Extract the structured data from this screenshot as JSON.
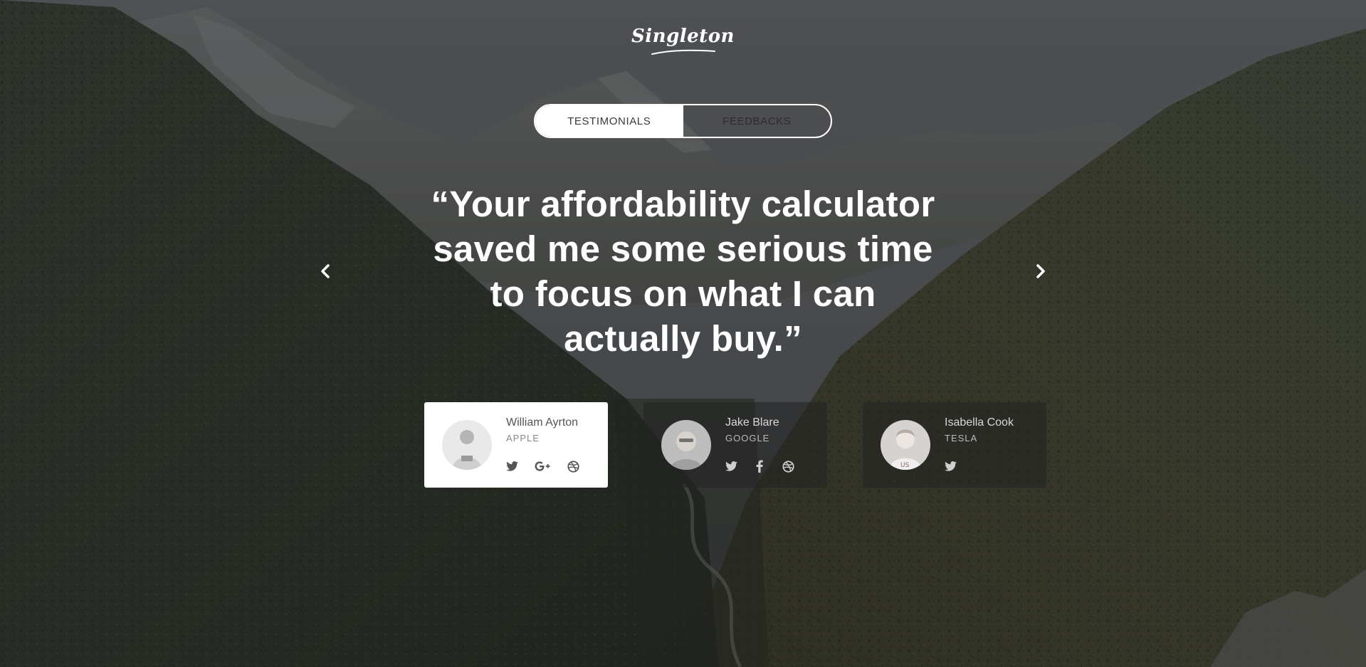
{
  "brand": {
    "logo_text": "Singleton"
  },
  "tabs": [
    {
      "label": "TESTIMONIALS",
      "active": true
    },
    {
      "label": "FEEDBACKS",
      "active": false
    }
  ],
  "quote": {
    "lines": [
      "“Your affordability calculator",
      "saved me some serious time",
      "to focus on what I can",
      "actually buy.”"
    ]
  },
  "navigation": {
    "prev_icon": "chevron-left-icon",
    "next_icon": "chevron-right-icon"
  },
  "testimonials": [
    {
      "name": "William Ayrton",
      "company": "APPLE",
      "active": true,
      "socials": [
        "twitter-icon",
        "google-plus-icon",
        "dribbble-icon"
      ]
    },
    {
      "name": "Jake Blare",
      "company": "GOOGLE",
      "active": false,
      "socials": [
        "twitter-icon",
        "facebook-icon",
        "dribbble-icon"
      ]
    },
    {
      "name": "Isabella Cook",
      "company": "TESLA",
      "active": false,
      "socials": [
        "twitter-icon"
      ]
    }
  ],
  "colors": {
    "text_light": "#ffffff",
    "card_active_bg": "#ffffff",
    "card_inactive_bg": "#232323",
    "overlay": "#141618"
  }
}
